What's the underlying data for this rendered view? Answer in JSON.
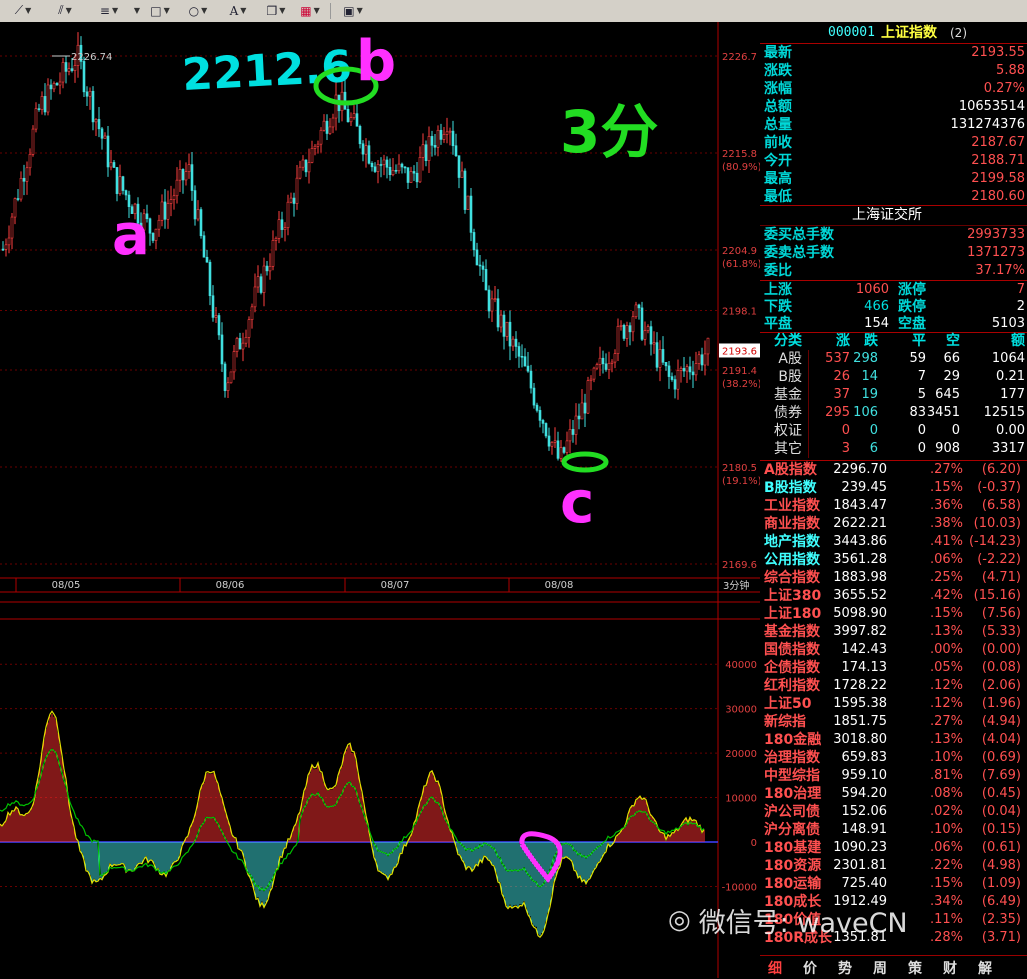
{
  "toolbar": {
    "icons": [
      "trend-line-icon",
      "parallel-lines-icon",
      "channel-icon",
      "fan-icon",
      "rectangle-icon",
      "circle-icon",
      "text-icon",
      "copy-icon",
      "color-palette-icon",
      "save-icon"
    ]
  },
  "chart": {
    "price_labels": [
      "2226.7",
      "2215.8",
      "(80.9%)",
      "2204.9",
      "(61.8%)",
      "2198.1",
      "2191.4",
      "(38.2%)",
      "2180.5",
      "(19.1%)",
      "2169.6"
    ],
    "current_price_tag": "2193.6",
    "high_marker": "2226.74",
    "dates": [
      "08/05",
      "08/06",
      "08/07",
      "08/08"
    ],
    "period": "3分钟",
    "volume_labels": [
      "40000",
      "30000",
      "20000",
      "10000",
      "0",
      "-10000"
    ],
    "annotations": {
      "top_number": "2212.6",
      "note": "3分",
      "a": "a",
      "b": "b",
      "c": "c"
    },
    "colors": {
      "up": "#ff4040",
      "down": "#40e0e0",
      "ma1": "#ffffff",
      "ma2": "#e0e000",
      "ma3": "#00c000",
      "axis": "#b00000"
    }
  },
  "chart_data": {
    "type": "line",
    "title": "",
    "xlabel": "",
    "ylabel": "",
    "x": [
      "08/05",
      "08/05",
      "08/05",
      "08/05",
      "08/05",
      "08/06",
      "08/06",
      "08/06",
      "08/06",
      "08/06",
      "08/07",
      "08/07",
      "08/07",
      "08/07",
      "08/07",
      "08/08",
      "08/08",
      "08/08",
      "08/08",
      "08/08"
    ],
    "series": [
      {
        "name": "",
        "values": [
          2205,
          2221,
          2226.7,
          2213,
          2207,
          2214,
          2190,
          2202,
          2213,
          2222,
          2215,
          2213,
          2220,
          2200,
          2192,
          2181,
          2191,
          2198,
          2190,
          2193.6
        ]
      }
    ],
    "ylim": [
      2169.6,
      2226.7
    ]
  },
  "quote": {
    "code": "000001",
    "name": "上证指数",
    "suffix": "(2)",
    "rows": [
      {
        "label": "最新",
        "value": "2193.55"
      },
      {
        "label": "涨跌",
        "value": "5.88"
      },
      {
        "label": "涨幅",
        "value": "0.27%"
      },
      {
        "label": "总额",
        "value": "10653514"
      },
      {
        "label": "总量",
        "value": "131274376"
      },
      {
        "label": "前收",
        "value": "2187.67"
      },
      {
        "label": "今开",
        "value": "2188.71"
      },
      {
        "label": "最高",
        "value": "2199.58"
      },
      {
        "label": "最低",
        "value": "2180.60"
      }
    ],
    "exchange": "上海证交所",
    "orders": [
      {
        "label": "委买总手数",
        "value": "2993733"
      },
      {
        "label": "委卖总手数",
        "value": "1371273"
      },
      {
        "label": "委比",
        "value": "37.17%"
      }
    ],
    "updown": [
      {
        "l1": "上涨",
        "v1": "1060",
        "l2": "涨停",
        "v2": "7"
      },
      {
        "l1": "下跌",
        "v1": "466",
        "l2": "跌停",
        "v2": "2"
      },
      {
        "l1": "平盘",
        "v1": "154",
        "l2": "空盘",
        "v2": "5103"
      }
    ]
  },
  "cat_table": {
    "headers": [
      "分类",
      "涨",
      "跌",
      "平",
      "空",
      "额"
    ],
    "rows": [
      [
        "A股",
        "537",
        "298",
        "59",
        "66",
        "1064"
      ],
      [
        "B股",
        "26",
        "14",
        "7",
        "29",
        "0.21"
      ],
      [
        "基金",
        "37",
        "19",
        "5",
        "645",
        "177"
      ],
      [
        "债券",
        "295",
        "106",
        "83",
        "3451",
        "12515"
      ],
      [
        "权证",
        "0",
        "0",
        "0",
        "0",
        "0.00"
      ],
      [
        "其它",
        "3",
        "6",
        "0",
        "908",
        "3317"
      ]
    ]
  },
  "indices": [
    {
      "name": "A股指数",
      "value": "2296.70",
      ".pct": "",
      "pct": ".27%",
      "chg": "6.20"
    },
    {
      "name": "B股指数",
      "value": "239.45",
      "pct": ".15%",
      "chg": "-0.37"
    },
    {
      "name": "工业指数",
      "value": "1843.47",
      "pct": ".36%",
      "chg": "6.58"
    },
    {
      "name": "商业指数",
      "value": "2622.21",
      "pct": ".38%",
      "chg": "10.03"
    },
    {
      "name": "地产指数",
      "value": "3443.86",
      "pct": ".41%",
      "chg": "-14.23"
    },
    {
      "name": "公用指数",
      "value": "3561.28",
      "pct": ".06%",
      "chg": "-2.22"
    },
    {
      "name": "综合指数",
      "value": "1883.98",
      "pct": ".25%",
      "chg": "4.71"
    },
    {
      "name": "上证380",
      "value": "3655.52",
      "pct": ".42%",
      "chg": "15.16"
    },
    {
      "name": "上证180",
      "value": "5098.90",
      "pct": ".15%",
      "chg": "7.56"
    },
    {
      "name": "基金指数",
      "value": "3997.82",
      "pct": ".13%",
      "chg": "5.33"
    },
    {
      "name": "国债指数",
      "value": "142.43",
      "pct": ".00%",
      "chg": "0.00"
    },
    {
      "name": "企债指数",
      "value": "174.13",
      "pct": ".05%",
      "chg": "0.08"
    },
    {
      "name": "红利指数",
      "value": "1728.22",
      "pct": ".12%",
      "chg": "2.06"
    },
    {
      "name": "上证50",
      "value": "1595.38",
      "pct": ".12%",
      "chg": "1.96"
    },
    {
      "name": "新综指",
      "value": "1851.75",
      "pct": ".27%",
      "chg": "4.94"
    },
    {
      "name": "180金融",
      "value": "3018.80",
      "pct": ".13%",
      "chg": "4.04"
    },
    {
      "name": "治理指数",
      "value": "659.83",
      "pct": ".10%",
      "chg": "0.69"
    },
    {
      "name": "中型综指",
      "value": "959.10",
      "pct": ".81%",
      "chg": "7.69"
    },
    {
      "name": "180治理",
      "value": "594.20",
      "pct": ".08%",
      "chg": "0.45"
    },
    {
      "name": "沪公司债",
      "value": "152.06",
      "pct": ".02%",
      "chg": "0.04"
    },
    {
      "name": "沪分离债",
      "value": "148.91",
      "pct": ".10%",
      "chg": "0.15"
    },
    {
      "name": "180基建",
      "value": "1090.23",
      "pct": ".06%",
      "chg": "0.61"
    },
    {
      "name": "180资源",
      "value": "2301.81",
      "pct": ".22%",
      "chg": "4.98"
    },
    {
      "name": "180运输",
      "value": "725.40",
      "pct": ".15%",
      "chg": "1.09"
    },
    {
      "name": "180成长",
      "value": "1912.49",
      "pct": ".34%",
      "chg": "6.49"
    },
    {
      "name": "180价值",
      "value": "",
      "pct": ".11%",
      "chg": "2.35"
    },
    {
      "name": "180R成长",
      "value": "1351.81",
      "pct": ".28%",
      "chg": "3.71"
    }
  ],
  "bottom_nav": [
    "细",
    "价",
    "势",
    "周",
    "策",
    "财",
    "解"
  ],
  "watermark": "微信号: waveCN"
}
